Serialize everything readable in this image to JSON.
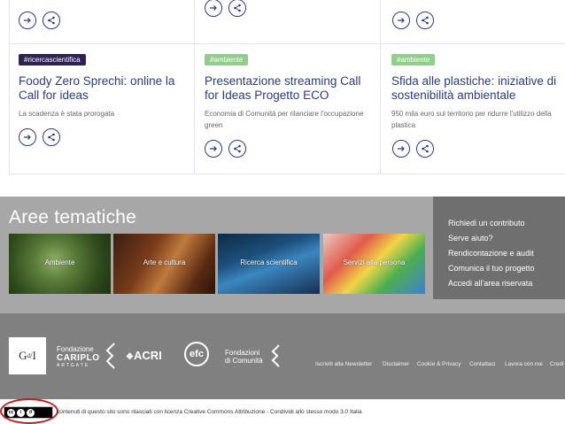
{
  "cards": [
    {
      "tag": "#ricercascientifica",
      "title": "Foody Zero Sprechi: online la Call for ideas",
      "desc": "La scadenza è stata prorogata"
    },
    {
      "tag": "#ambiente",
      "title": "Presentazione streaming Call for Ideas Progetto ECO",
      "desc": "Economia di Comunità per rilanciare l'occupazione green"
    },
    {
      "tag": "#ambiente",
      "title": "Sfida alle plastiche: iniziative di sostenibilità ambientale",
      "desc": "950 mila euro sul territorio per ridurre l'utilizzo della plastica"
    }
  ],
  "aree": {
    "title": "Aree tematiche",
    "tiles": [
      "Ambiente",
      "Arte e cultura",
      "Ricerca scientifica",
      "Servizi alla persona"
    ]
  },
  "sidebar": {
    "links": [
      "Richiedi un contributo",
      "Serve aiuto?",
      "Rendicontazione e audit",
      "Comunica il tuo progetto",
      "Accedi all'area riservata"
    ]
  },
  "footer": {
    "gdi": "G",
    "gdi_sup": "d",
    "gdi_end": "I",
    "cariplo_line1": "Fondazione",
    "cariplo_line2": "CARIPLO",
    "cariplo_line3": "ARTGATE",
    "acri": "ACRI",
    "efc": "efc",
    "fdc_line1": "Fondazioni",
    "fdc_line2": "di Comunità",
    "links": [
      "Iscriviti alla Newsletter",
      "Disclaimer",
      "Cookie & Privacy",
      "Contattaci",
      "Lavora con noi",
      "Credi"
    ]
  },
  "license": {
    "text": "contenuti di questo sito sono rilasciati con licenza Creative Commons Attribuzione - Condividi allo stesso modo 3.0 Italia",
    "badge": "cc"
  },
  "colors": {
    "accent": "#2a3a86",
    "tag_dark": "#2e2156",
    "tag_green": "#8fcf8a",
    "aree_bg": "#a7a7a7",
    "sidebar_bg": "#6f6f6f",
    "footer_bg": "#808080",
    "highlight": "#c0201e"
  },
  "icons": [
    "arrow-right-icon",
    "share-icon"
  ]
}
